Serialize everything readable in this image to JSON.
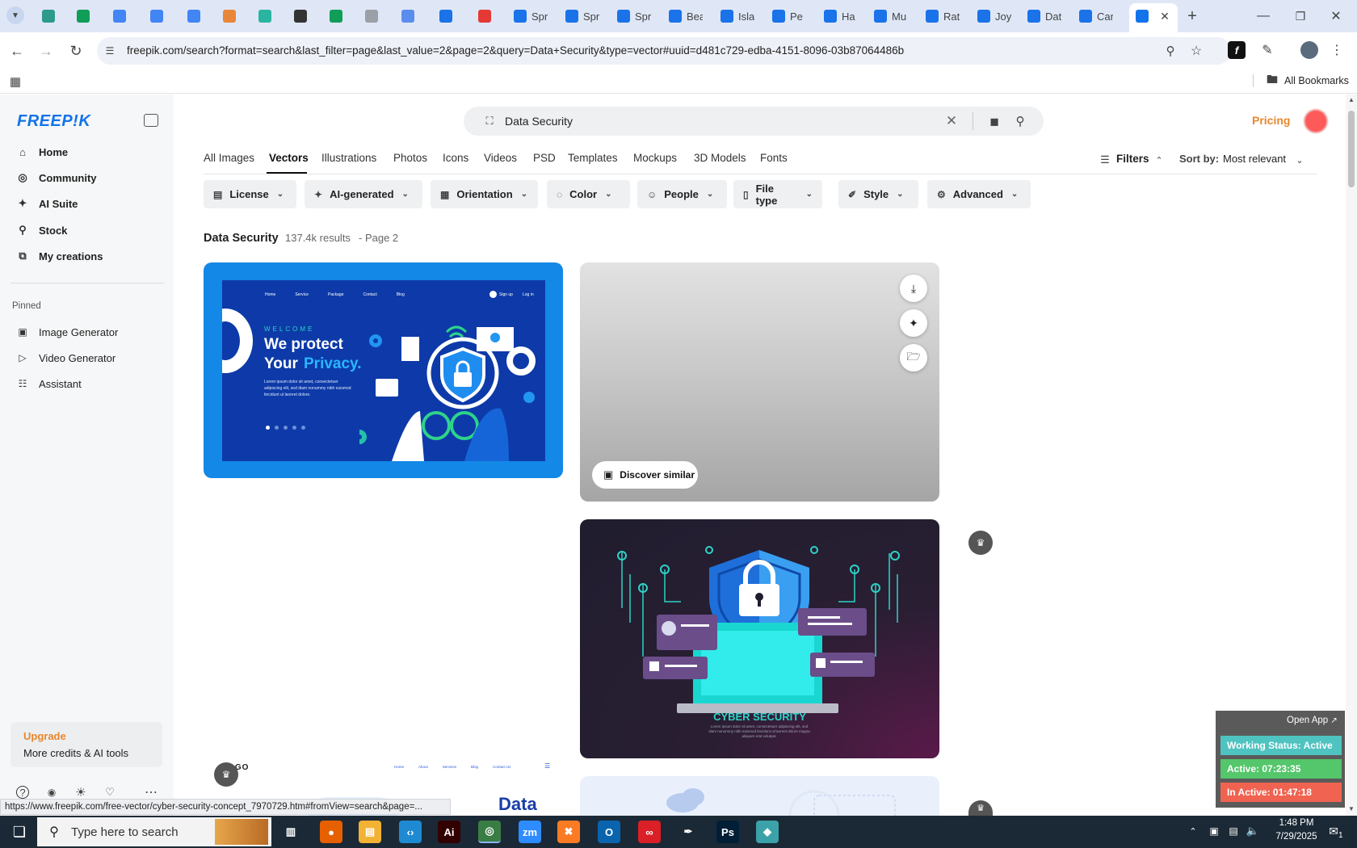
{
  "browser": {
    "tabs": [
      {
        "label": "",
        "color": "#2d9a8c"
      },
      {
        "label": "",
        "color": "#0f9d58"
      },
      {
        "label": "",
        "color": "#4285f4"
      },
      {
        "label": "",
        "color": "#4285f4"
      },
      {
        "label": "",
        "color": "#4285f4"
      },
      {
        "label": "",
        "color": "#e8873a"
      },
      {
        "label": "",
        "color": "#2ab5a0"
      },
      {
        "label": "",
        "color": "#333333"
      },
      {
        "label": "",
        "color": "#0f9d58"
      },
      {
        "label": "",
        "color": "#9aa0a6"
      },
      {
        "label": "",
        "color": "#5b8def"
      },
      {
        "label": "",
        "color": "#1a73e8"
      },
      {
        "label": "",
        "color": "#e53935"
      },
      {
        "label": "Spr",
        "color": "#1a73e8"
      },
      {
        "label": "Spr",
        "color": "#1a73e8"
      },
      {
        "label": "Spr",
        "color": "#1a73e8"
      },
      {
        "label": "Bea",
        "color": "#1a73e8"
      },
      {
        "label": "Isla",
        "color": "#1a73e8"
      },
      {
        "label": "Pe",
        "color": "#1a73e8"
      },
      {
        "label": "Ha",
        "color": "#1a73e8"
      },
      {
        "label": "Mu",
        "color": "#1a73e8"
      },
      {
        "label": "Rat",
        "color": "#1a73e8"
      },
      {
        "label": "Joy",
        "color": "#1a73e8"
      },
      {
        "label": "Dat",
        "color": "#1a73e8"
      },
      {
        "label": "Car",
        "color": "#1a73e8"
      }
    ],
    "url": "freepik.com/search?format=search&last_filter=page&last_value=2&page=2&query=Data+Security&type=vector#uuid=d481c729-edba-4151-8096-03b87064486b",
    "all_bookmarks": "All Bookmarks",
    "status_url": "https://www.freepik.com/free-vector/cyber-security-concept_7970729.htm#fromView=search&page=..."
  },
  "sidebar": {
    "logo": "FREEP!K",
    "nav": [
      {
        "label": "Home",
        "icon": "home-icon"
      },
      {
        "label": "Community",
        "icon": "globe-icon"
      },
      {
        "label": "AI Suite",
        "icon": "sparkle-icon"
      },
      {
        "label": "Stock",
        "icon": "search-icon"
      },
      {
        "label": "My creations",
        "icon": "layers-icon"
      }
    ],
    "pinned_title": "Pinned",
    "pinned": [
      {
        "label": "Image Generator",
        "icon": "image-icon"
      },
      {
        "label": "Video Generator",
        "icon": "video-icon"
      },
      {
        "label": "Assistant",
        "icon": "chat-icon"
      }
    ],
    "upgrade": {
      "title": "Upgrade",
      "subtitle": "More credits & AI tools"
    }
  },
  "header": {
    "search_value": "Data Security",
    "pricing": "Pricing"
  },
  "categories": [
    "All Images",
    "Vectors",
    "Illustrations",
    "Photos",
    "Icons",
    "Videos",
    "PSD",
    "Templates",
    "Mockups",
    "3D Models",
    "Fonts"
  ],
  "active_category": "Vectors",
  "filters_label": "Filters",
  "sort": {
    "label": "Sort by:",
    "value": "Most relevant"
  },
  "filter_chips": [
    "License",
    "AI-generated",
    "Orientation",
    "Color",
    "People",
    "File type",
    "Style",
    "Advanced"
  ],
  "results": {
    "query": "Data Security",
    "count": "137.4k results",
    "page": "- Page 2"
  },
  "cards": {
    "card1": {
      "nav": [
        "Home",
        "Service",
        "Package",
        "Contact",
        "Blog"
      ],
      "signup": "Sign up",
      "login": "Log in",
      "welcome": "WELCOME",
      "headline1": "We protect",
      "headline2a": "Your",
      "headline2b": "Privacy.",
      "body": "Lorem ipsum dolor sit amet, consectetuer adipiscing elit, sed diam nonummy nibh euismod tincidunt ut laoreet dolore."
    },
    "card2": {
      "discover": "Discover similar"
    },
    "card3": {
      "title": "CYBER SECURITY",
      "body": "Lorem ipsum dolor sit amet, consectetuer adipiscing elit, sed diam nonummy nibh euismod tincidunt ut laoreet dolore magna aliquam erat volutpat."
    },
    "card4": {
      "logo": "LOGO",
      "nav": [
        "Home",
        "About",
        "Services",
        "Blog",
        "Contact Us"
      ],
      "title": "Data"
    }
  },
  "widget": {
    "open_app": "Open App",
    "status": "Working Status: Active",
    "active": "Active: 07:23:35",
    "inactive": "In Active: 01:47:18"
  },
  "taskbar": {
    "search_placeholder": "Type here to search",
    "time": "1:48 PM",
    "date": "7/29/2025",
    "notifications": "1"
  },
  "colors": {
    "accent": "#1273eb",
    "pricing": "#e8872d",
    "upgrade": "#e8872d"
  }
}
